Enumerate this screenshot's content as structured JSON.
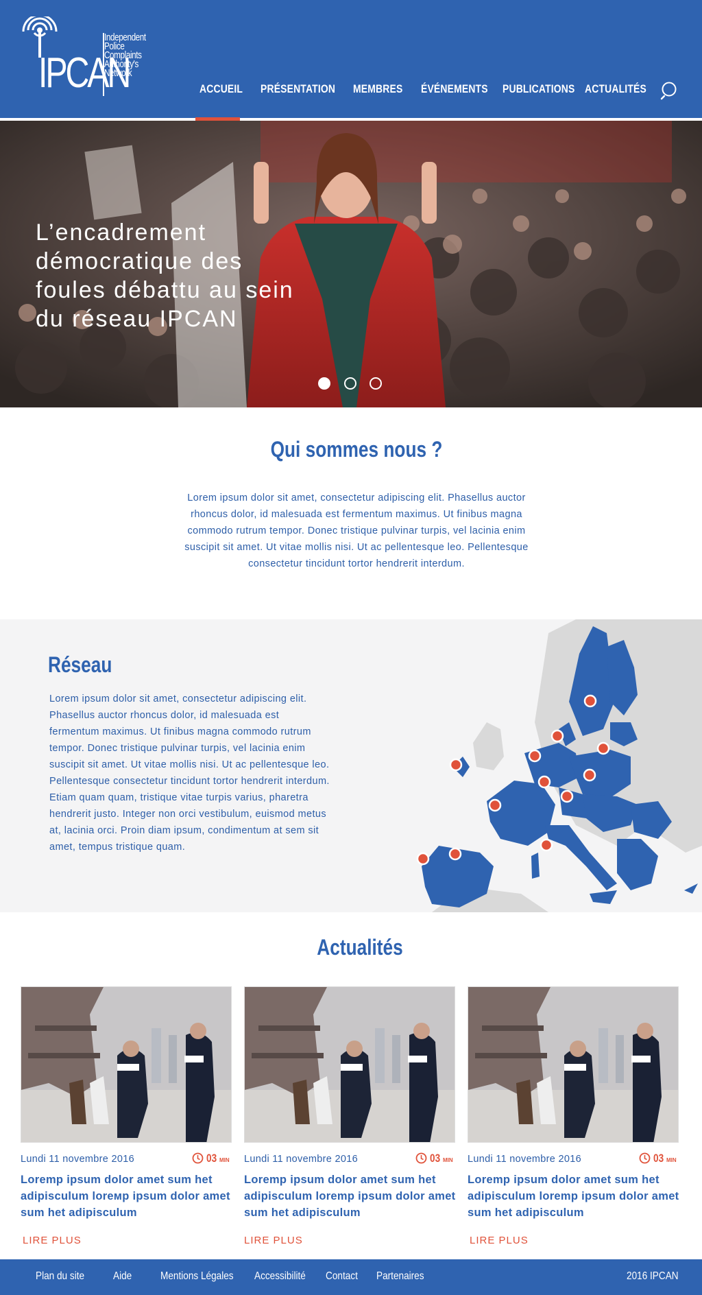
{
  "header": {
    "logo_text": "IPCAN",
    "logo_sub": [
      "Independent",
      "Police",
      "Complaints",
      "Authority's",
      "Network"
    ],
    "nav": [
      {
        "label": "ACCUEIL",
        "active": true
      },
      {
        "label": "PRÉSENTATION",
        "active": false
      },
      {
        "label": "MEMBRES",
        "active": false
      },
      {
        "label": "ÉVÉNEMENTS",
        "active": false
      },
      {
        "label": "PUBLICATIONS",
        "active": false
      },
      {
        "label": "ACTUALITÉS",
        "active": false
      }
    ],
    "search_icon": "search-icon"
  },
  "hero": {
    "title": "L’encadrement démocratique des foules débattu au sein du réseau IPCAN",
    "slides": 3,
    "active_slide": 1
  },
  "about": {
    "title": "Qui sommes nous ?",
    "text": "Lorem ipsum dolor sit amet, consectetur adipiscing elit. Phasellus auctor rhoncus dolor, id malesuada est fermentum maximus. Ut finibus magna commodo rutrum tempor. Donec tristique pulvinar turpis, vel lacinia enim suscipit sit amet. Ut vitae mollis nisi. Ut ac pellentesque leo. Pellentesque consectetur tincidunt tortor hendrerit interdum."
  },
  "network": {
    "title": "Réseau",
    "text": "Lorem ipsum dolor sit amet, consectetur adipiscing elit. Phasellus auctor rhoncus dolor, id malesuada est fermentum maximus. Ut finibus magna commodo rutrum tempor. Donec tristique pulvinar turpis, vel lacinia enim suscipit sit amet. Ut vitae mollis nisi. Ut ac pellentesque leo. Pellentesque consectetur tincidunt tortor hendrerit interdum. Etiam quam quam, tristique vitae turpis varius, pharetra hendrerit justo. Integer non orci vestibulum, euismod metus at, lacinia orci. Proin diam ipsum, condimentum at sem sit amet, tempus tristique quam."
  },
  "news": {
    "title": "Actualités",
    "items": [
      {
        "date": "Lundi 11 novembre 2016",
        "time_value": "03",
        "time_unit": "MIN",
        "title": "Loremp ipsum dolor amet sum het adipisculum lorемp ipsum dolor amet sum het adipisculum",
        "link": "LIRE PLUS"
      },
      {
        "date": "Lundi 11 novembre 2016",
        "time_value": "03",
        "time_unit": "MIN",
        "title": "Loremp ipsum dolor amet sum het adipisculum loremp ipsum dolor amet sum het adipisculum",
        "link": "LIRE PLUS"
      },
      {
        "date": "Lundi 11 novembre 2016",
        "time_value": "03",
        "time_unit": "MIN",
        "title": "Loremp ipsum dolor amet sum het adipisculum loremp ipsum dolor amet sum het adipisculum",
        "link": "LIRE PLUS"
      }
    ]
  },
  "footer": {
    "links": [
      "Plan du site",
      "Aide",
      "Mentions Légales",
      "Accessibilité",
      "Contact",
      "Partenaires"
    ],
    "copyright": "2016 IPCAN"
  },
  "colors": {
    "brand_blue": "#2f63b0",
    "accent_red": "#e0523a",
    "section_grey": "#f4f4f5"
  }
}
